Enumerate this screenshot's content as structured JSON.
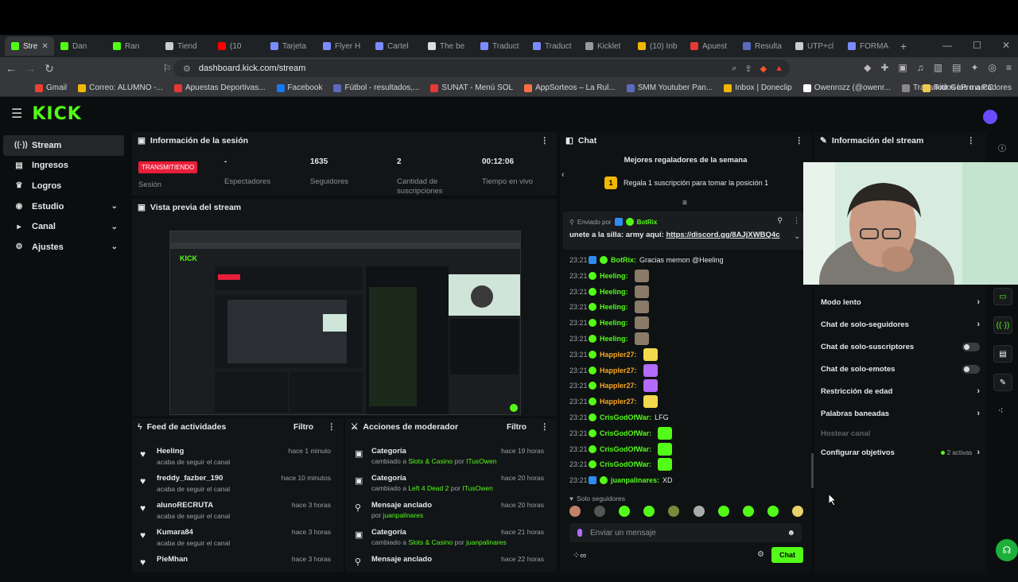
{
  "browser": {
    "tabs": [
      {
        "label": "Stre",
        "color": "#53fc18"
      },
      {
        "label": "Dan",
        "color": "#53fc18"
      },
      {
        "label": "Ran",
        "color": "#53fc18"
      },
      {
        "label": "Tiend",
        "color": "#ccc"
      },
      {
        "label": "(10",
        "color": "#ff0000"
      },
      {
        "label": "Tarjeta",
        "color": "#7b8cff"
      },
      {
        "label": "Flyer H",
        "color": "#7b8cff"
      },
      {
        "label": "Cartel",
        "color": "#7b8cff"
      },
      {
        "label": "The be",
        "color": "#ddd"
      },
      {
        "label": "Traduct",
        "color": "#7b8cff"
      },
      {
        "label": "Traduct",
        "color": "#7b8cff"
      },
      {
        "label": "Kicklet",
        "color": "#999"
      },
      {
        "label": "(10) Inb",
        "color": "#f2b705"
      },
      {
        "label": "Apuest",
        "color": "#e53935"
      },
      {
        "label": "Resulta",
        "color": "#5c6bc0"
      },
      {
        "label": "UTP+cl",
        "color": "#ccc"
      },
      {
        "label": "FORMA",
        "color": "#7b8cff"
      }
    ],
    "url": "dashboard.kick.com/stream",
    "bookmarks": [
      {
        "label": "Gmail",
        "color": "#ea4335"
      },
      {
        "label": "Correo: ALUMNO -...",
        "color": "#f2b705"
      },
      {
        "label": "Apuestas Deportivas...",
        "color": "#e53935"
      },
      {
        "label": "Facebook",
        "color": "#1877f2"
      },
      {
        "label": "Fútbol - resultados,...",
        "color": "#5c6bc0"
      },
      {
        "label": "SUNAT - Menú SOL",
        "color": "#e53935"
      },
      {
        "label": "AppSorteos – La Rul...",
        "color": "#ff7043"
      },
      {
        "label": "SMM Youtuber Pan...",
        "color": "#5c6bc0"
      },
      {
        "label": "Inbox | Doneclip",
        "color": "#f2b705"
      },
      {
        "label": "Owenrozz (@owenr...",
        "color": "#fff"
      },
      {
        "label": "Transmitir GoPro a PC",
        "color": "#888"
      }
    ],
    "all_bookmarks": "Todos los marcadores"
  },
  "sidebar": {
    "items": [
      {
        "label": "Stream",
        "icon": "broadcast-icon"
      },
      {
        "label": "Ingresos",
        "icon": "wallet-icon"
      },
      {
        "label": "Logros",
        "icon": "trophy-icon"
      },
      {
        "label": "Estudio",
        "icon": "studio-icon"
      },
      {
        "label": "Canal",
        "icon": "channel-icon"
      },
      {
        "label": "Ajustes",
        "icon": "gear-icon"
      }
    ]
  },
  "session": {
    "title": "Información de la sesión",
    "live_badge": "TRANSMITIENDO",
    "session_label": "Sesión",
    "stats": [
      {
        "value": "-",
        "label": "Espectadores"
      },
      {
        "value": "1635",
        "label": "Seguidores"
      },
      {
        "value": "2",
        "label": "Cantidad de suscripciones"
      },
      {
        "value": "00:12:06",
        "label": "Tiempo en vivo"
      }
    ]
  },
  "preview": {
    "title": "Vista previa del stream"
  },
  "feed": {
    "title": "Feed de actividades",
    "filter": "Filtro",
    "items": [
      {
        "name": "Heeling",
        "desc": "acaba de seguir el canal",
        "time": "hace 1 minuto"
      },
      {
        "name": "freddy_fazber_190",
        "desc": "acaba de seguir el canal",
        "time": "hace 10 minutos"
      },
      {
        "name": "alunoRECRUTA",
        "desc": "acaba de seguir el canal",
        "time": "hace 3 horas"
      },
      {
        "name": "Kumara84",
        "desc": "acaba de seguir el canal",
        "time": "hace 3 horas"
      },
      {
        "name": "PieMhan",
        "desc": "",
        "time": "hace 3 horas"
      }
    ]
  },
  "mod": {
    "title": "Acciones de moderador",
    "filter": "Filtro",
    "items": [
      {
        "name": "Categoría",
        "pre": "cambiado a ",
        "g1": "Slots & Casino",
        "mid": " por ",
        "g2": "ITusOwen",
        "time": "hace 19 horas"
      },
      {
        "name": "Categoría",
        "pre": "cambiado a ",
        "g1": "Left 4 Dead 2",
        "mid": " por ",
        "g2": "ITusOwen",
        "time": "hace 20 horas"
      },
      {
        "name": "Mensaje anclado",
        "pre": "por ",
        "g1": "juanpalinares",
        "mid": "",
        "g2": "",
        "time": "hace 20 horas"
      },
      {
        "name": "Categoría",
        "pre": "cambiado a ",
        "g1": "Slots & Casino",
        "mid": " por ",
        "g2": "juanpalinares",
        "time": "hace 21 horas"
      },
      {
        "name": "Mensaje anclado",
        "pre": "",
        "g1": "",
        "mid": "",
        "g2": "",
        "time": "hace 22 horas"
      }
    ]
  },
  "chat": {
    "title": "Chat",
    "gifters_title": "Mejores regaladores de la semana",
    "gift_rank": "1",
    "gift_text": "Regala 1 suscripción para tomar la posición 1",
    "pinned_by_label": "Enviado por",
    "pinned_user": "BotRix",
    "pinned_text": "unete a la silla: army aquí:",
    "pinned_link": "https://discord.gg/8AJjXWBQ4c",
    "messages": [
      {
        "time": "23:21",
        "user": "BotRix:",
        "text": " Gracias memon @Heeling",
        "color": "#53fc18",
        "emote": ""
      },
      {
        "time": "23:21",
        "user": "Heeling:",
        "text": "",
        "color": "#53fc18",
        "emote": "#8a7a6a"
      },
      {
        "time": "23:21",
        "user": "Heeling:",
        "text": "",
        "color": "#53fc18",
        "emote": "#8a7a6a"
      },
      {
        "time": "23:21",
        "user": "Heeling:",
        "text": "",
        "color": "#53fc18",
        "emote": "#8a7a6a"
      },
      {
        "time": "23:21",
        "user": "Heeling:",
        "text": "",
        "color": "#53fc18",
        "emote": "#8a7a6a"
      },
      {
        "time": "23:21",
        "user": "Heeling:",
        "text": "",
        "color": "#53fc18",
        "emote": "#8a7a6a"
      },
      {
        "time": "23:21",
        "user": "Happler27:",
        "text": "",
        "color": "#f5a623",
        "emote": "#f2d94e"
      },
      {
        "time": "23:21",
        "user": "Happler27:",
        "text": "",
        "color": "#f5a623",
        "emote": "#b36bff"
      },
      {
        "time": "23:21",
        "user": "Happler27:",
        "text": "",
        "color": "#f5a623",
        "emote": "#b36bff"
      },
      {
        "time": "23:21",
        "user": "Happler27:",
        "text": "",
        "color": "#f5a623",
        "emote": "#f2d94e"
      },
      {
        "time": "23:21",
        "user": "CrisGodOfWar:",
        "text": " LFG",
        "color": "#53fc18",
        "emote": ""
      },
      {
        "time": "23:21",
        "user": "CrisGodOfWar:",
        "text": "",
        "color": "#53fc18",
        "emote": "#53fc18"
      },
      {
        "time": "23:21",
        "user": "CrisGodOfWar:",
        "text": "",
        "color": "#53fc18",
        "emote": "#53fc18"
      },
      {
        "time": "23:21",
        "user": "CrisGodOfWar:",
        "text": "",
        "color": "#53fc18",
        "emote": "#53fc18"
      },
      {
        "time": "23:21",
        "user": "juanpalinares:",
        "text": " XD",
        "color": "#53fc18",
        "emote": ""
      }
    ],
    "followers_only": "Solo seguidores",
    "placeholder": "Enviar un mensaje",
    "send_label": "Chat"
  },
  "stream_info": {
    "title": "Información del stream",
    "items": [
      {
        "label": "Modo lento",
        "control": "chevron"
      },
      {
        "label": "Chat de solo-seguidores",
        "control": "chevron"
      },
      {
        "label": "Chat de solo-suscriptores",
        "control": "toggle"
      },
      {
        "label": "Chat de solo-emotes",
        "control": "toggle"
      },
      {
        "label": "Restricción de edad",
        "control": "chevron"
      },
      {
        "label": "Palabras baneadas",
        "control": "chevron"
      },
      {
        "label": "Hostear canal",
        "control": "none"
      },
      {
        "label": "Configurar objetivos",
        "control": "chevron"
      }
    ],
    "objectives_status": "2 activas"
  },
  "colors": {
    "accent": "#53fc18",
    "live": "#e91e3a"
  }
}
